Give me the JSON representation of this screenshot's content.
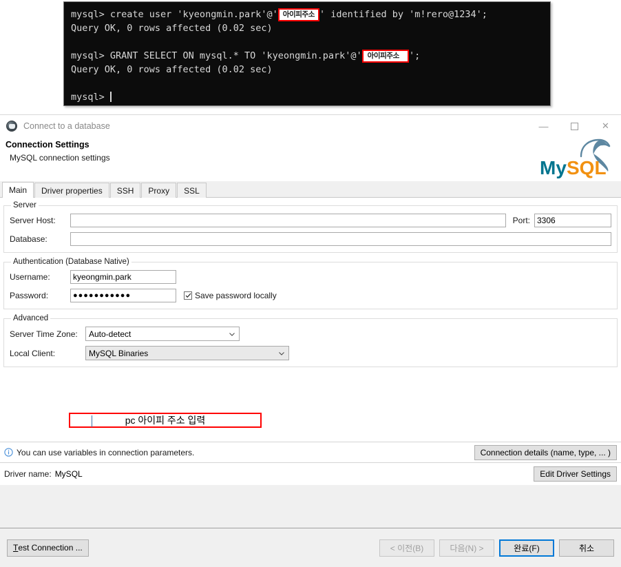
{
  "terminal": {
    "lines": [
      {
        "type": "cmd",
        "pre": "mysql> create user 'kyeongmin.park'@'",
        "redacted": "아이피주소",
        "post": "' identified by 'm!rero@1234';"
      },
      {
        "type": "text",
        "text": "Query OK, 0 rows affected (0.02 sec)"
      },
      {
        "type": "blank"
      },
      {
        "type": "cmd",
        "pre": "mysql> GRANT SELECT ON mysql.* TO 'kyeongmin.park'@'",
        "redacted": "아이피주소",
        "post": "';"
      },
      {
        "type": "text",
        "text": "Query OK, 0 rows affected (0.02 sec)"
      },
      {
        "type": "blank"
      },
      {
        "type": "prompt",
        "text": "mysql>"
      }
    ],
    "line1_pre": "mysql> create user 'kyeongmin.park'@'",
    "line1_redacted": "아이피주소",
    "line1_post": "' identified by 'm!rero@1234';",
    "line2": "Query OK, 0 rows affected (0.02 sec)",
    "line4_pre": "mysql> GRANT SELECT ON mysql.* TO 'kyeongmin.park'@'",
    "line4_redacted": "아이피주소",
    "line4_post": "';",
    "line5": "Query OK, 0 rows affected (0.02 sec)",
    "line7": "mysql>"
  },
  "dialog": {
    "title": "Connect to a database",
    "header_title": "Connection Settings",
    "header_subtitle": "MySQL connection settings",
    "logo_text_my": "My",
    "logo_text_sql": "SQL",
    "window_controls": {
      "minimize": "minimize-icon",
      "maximize": "maximize-icon",
      "close": "✕"
    }
  },
  "tabs": [
    {
      "label": "Main",
      "active": true
    },
    {
      "label": "Driver properties",
      "active": false
    },
    {
      "label": "SSH",
      "active": false
    },
    {
      "label": "Proxy",
      "active": false
    },
    {
      "label": "SSL",
      "active": false
    }
  ],
  "server_group": {
    "legend": "Server",
    "host_label": "Server Host:",
    "host_value": "",
    "port_label": "Port:",
    "port_value": "3306",
    "database_label": "Database:",
    "database_value": ""
  },
  "annotation": {
    "host_overlay_text": "pc 아이피 주소 입력",
    "color": "#ff0000"
  },
  "auth_group": {
    "legend": "Authentication (Database Native)",
    "username_label": "Username:",
    "username_value": "kyeongmin.park",
    "password_label": "Password:",
    "password_value": "●●●●●●●●●●●",
    "save_password_label": "Save password locally",
    "save_password_checked": true
  },
  "advanced_group": {
    "legend": "Advanced",
    "timezone_label": "Server Time Zone:",
    "timezone_value": "Auto-detect",
    "local_client_label": "Local Client:",
    "local_client_value": "MySQL Binaries"
  },
  "info_row": {
    "icon": "info-icon",
    "text": "You can use variables in connection parameters.",
    "button_label": "Connection details (name, type, ... )"
  },
  "driver_row": {
    "label": "Driver name:",
    "value": "MySQL",
    "button_label": "Edit Driver Settings"
  },
  "buttons": {
    "test_connection": "Test Connection ...",
    "back": "< 이전(B)",
    "next": "다음(N) >",
    "finish": "완료(F)",
    "cancel": "취소"
  }
}
